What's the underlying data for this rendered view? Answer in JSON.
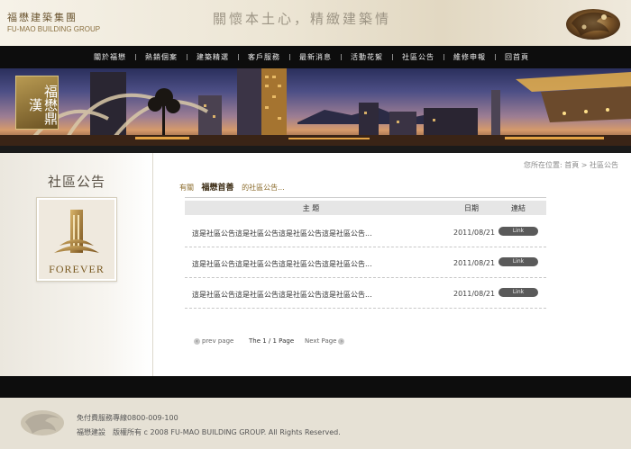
{
  "header": {
    "logo_cn": "福懋建築集團",
    "logo_en": "FU-MAO BUILDING GROUP",
    "slogan": "關懷本土心，精緻建築情"
  },
  "nav": {
    "items": [
      "關於福懋",
      "熱銷個案",
      "建築精選",
      "客戶服務",
      "最新消息",
      "活動花絮",
      "社區公告",
      "維修申報",
      "回首頁"
    ]
  },
  "banner": {
    "badge_text": "福懋鼎漢"
  },
  "left_panel": {
    "title": "社區公告",
    "card_text": "FOREVER"
  },
  "breadcrumb": "您所在位置: 首頁 > 社區公告",
  "intro": {
    "prefix": "有關",
    "project": "福懋首善",
    "suffix": "的社區公告..."
  },
  "table": {
    "headers": [
      "主 題",
      "日期",
      "連結"
    ],
    "rows": [
      {
        "title": "這是社區公告這是社區公告這是社區公告這是社區公告...",
        "date": "2011/08/21",
        "link": "Link"
      },
      {
        "title": "這是社區公告這是社區公告這是社區公告這是社區公告...",
        "date": "2011/08/21",
        "link": "Link"
      },
      {
        "title": "這是社區公告這是社區公告這是社區公告這是社區公告...",
        "date": "2011/08/21",
        "link": "Link"
      }
    ]
  },
  "pager": {
    "prev": "prev page",
    "status": "The 1 / 1 Page",
    "next": "Next Page"
  },
  "footer": {
    "line1": "免付費服務專線0800-009-100",
    "line2": "福懋建設　版權所有 c 2008 FU-MAO BUILDING GROUP. All Rights Reserved."
  },
  "colors": {
    "nav_bg": "#0d0d0d",
    "gold": "#8a6a2a",
    "link_pill": "#5a5a5a"
  }
}
